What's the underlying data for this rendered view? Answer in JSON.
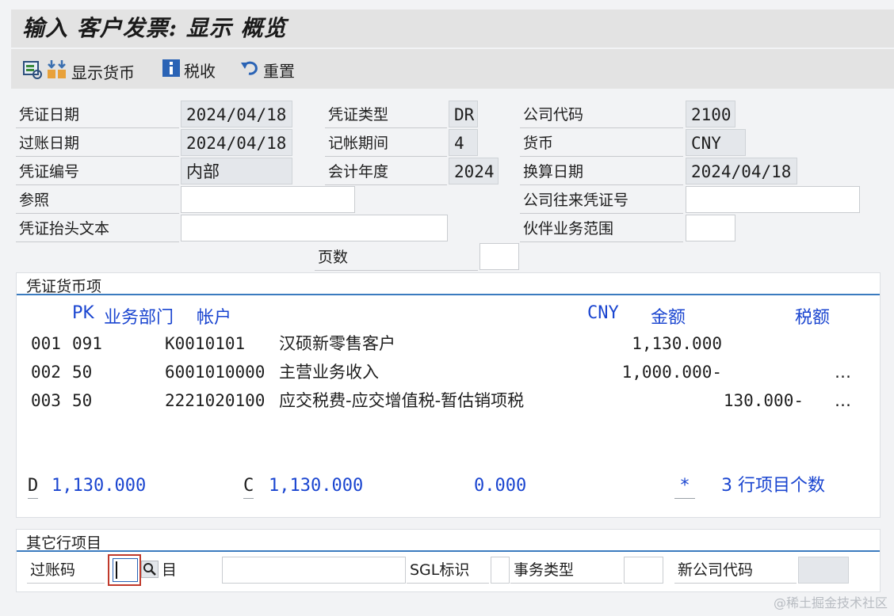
{
  "title": "输入 客户发票: 显示 概览",
  "toolbar": {
    "display_currency": "显示货币",
    "tax": "税收",
    "reset": "重置"
  },
  "header": {
    "doc_date_label": "凭证日期",
    "doc_date": "2024/04/18",
    "doc_type_label": "凭证类型",
    "doc_type": "DR",
    "company_code_label": "公司代码",
    "company_code": "2100",
    "posting_date_label": "过账日期",
    "posting_date": "2024/04/18",
    "period_label": "记帐期间",
    "period": "4",
    "currency_label": "货币",
    "currency": "CNY",
    "doc_number_label": "凭证编号",
    "doc_number": "内部",
    "fiscal_year_label": "会计年度",
    "fiscal_year": "2024",
    "translation_date_label": "换算日期",
    "translation_date": "2024/04/18",
    "reference_label": "参照",
    "reference": "",
    "intercompany_label": "公司往来凭证号",
    "intercompany": "",
    "header_text_label": "凭证抬头文本",
    "header_text": "",
    "trading_partner_label": "伙伴业务范围",
    "trading_partner": "",
    "page_label": "页数",
    "page": ""
  },
  "items_group": {
    "title": "凭证货币项",
    "col_pk": "PK",
    "col_ba": "业务部门",
    "col_account": "帐户",
    "col_currency": "CNY",
    "col_amount": "金额",
    "col_tax": "税额",
    "rows": [
      {
        "no": "001",
        "pk": "091",
        "account": "K0010101",
        "desc": "汉硕新零售客户",
        "amount": "1,130.000",
        "tax": "",
        "more": ""
      },
      {
        "no": "002",
        "pk": "50",
        "account": "6001010000",
        "desc": "主营业务收入",
        "amount": "1,000.000-",
        "tax": "",
        "more": "…"
      },
      {
        "no": "003",
        "pk": "50",
        "account": "2221020100",
        "desc": "应交税费-应交增值税-暂估销项税",
        "amount": "",
        "tax": "130.000-",
        "more": "…"
      }
    ],
    "debit_label": "D",
    "debit_total": "1,130.000",
    "credit_label": "C",
    "credit_total": "1,130.000",
    "balance": "0.000",
    "star": "*",
    "line_count": "3 行项目个数"
  },
  "other_group": {
    "title": "其它行项目",
    "posting_key_label": "过账码",
    "posting_key": "",
    "account_label": "目",
    "sgl_label": "SGL标识",
    "trans_type_label": "事务类型",
    "new_company_label": "新公司代码"
  },
  "watermark": "@稀土掘金技术社区",
  "colors": {
    "accent": "#1a45d0",
    "group_line": "#3b7bbf",
    "readonly_bg": "#e4e7eb"
  }
}
